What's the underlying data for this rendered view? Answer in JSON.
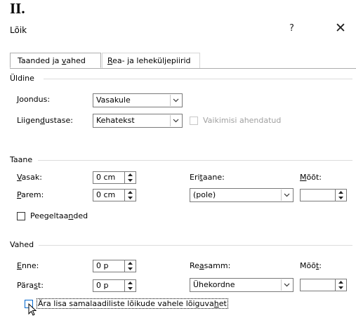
{
  "heading": "II.",
  "dialog": {
    "title": "Lõik",
    "help_label": "?",
    "close_label": "✕"
  },
  "tabs": [
    {
      "pre": "Taanded ja ",
      "key": "v",
      "post": "ahed"
    },
    {
      "pre": "",
      "key": "R",
      "post": "ea- ja leheküljepiirid"
    }
  ],
  "general": {
    "section_label": "Üldine",
    "alignment_label": {
      "pre": "",
      "key": "J",
      "post": "oondus:"
    },
    "alignment_value": "Vasakule",
    "outline_label": {
      "pre": "Liigen",
      "key": "d",
      "post": "ustase:"
    },
    "outline_value": "Kehatekst",
    "collapsed_label": "Vaikimisi ahendatud"
  },
  "indent": {
    "section_label": "Taane",
    "left_label": {
      "pre": "",
      "key": "V",
      "post": "asak:"
    },
    "left_value": "0 cm",
    "right_label": {
      "pre": "",
      "key": "P",
      "post": "arem:"
    },
    "right_value": "0 cm",
    "special_label": {
      "pre": "Eri",
      "key": "t",
      "post": "aane:"
    },
    "special_value": "(pole)",
    "by_label": {
      "pre": "",
      "key": "M",
      "post": "õõt:"
    },
    "by_value": "",
    "mirror_label": {
      "pre": "Peegeltaa",
      "key": "n",
      "post": "ded"
    }
  },
  "spacing": {
    "section_label": "Vahed",
    "before_label": {
      "pre": "",
      "key": "E",
      "post": "nne:"
    },
    "before_value": "0 p",
    "after_label": {
      "pre": "Pära",
      "key": "s",
      "post": "t:"
    },
    "after_value": "0 p",
    "line_label": {
      "pre": "Re",
      "key": "a",
      "post": "samm:"
    },
    "line_value": "Ühekordne",
    "at_label": {
      "pre": "Mõõ",
      "key": "t",
      "post": ":"
    },
    "at_value": "",
    "dont_add_label": {
      "pre": "Ära lisa samalaadiliste lõikude vahele lõiguva",
      "key": "h",
      "post": "et"
    }
  }
}
